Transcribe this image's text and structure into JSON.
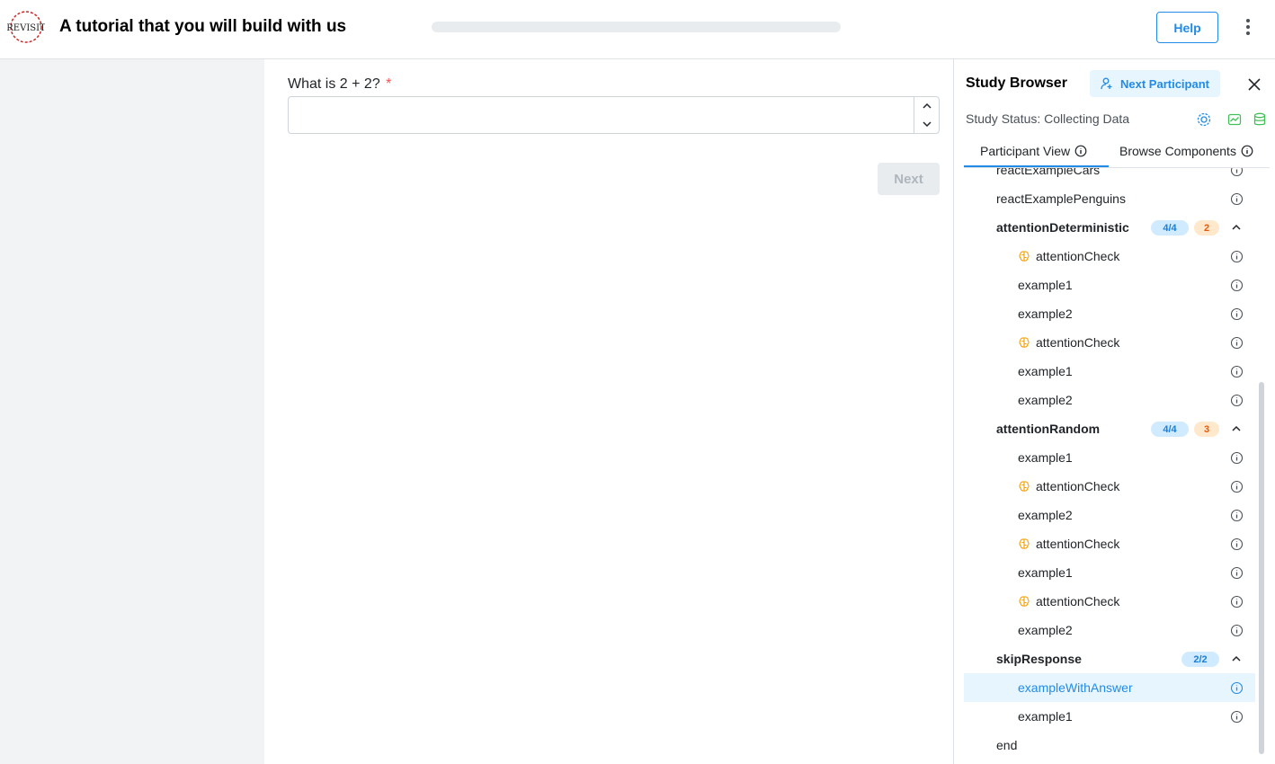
{
  "header": {
    "title": "A tutorial that you will build with us",
    "logo_text": "REVISIT",
    "help_label": "Help"
  },
  "question": {
    "label": "What is 2 + 2?",
    "required_mark": "*",
    "value": "",
    "next_label": "Next"
  },
  "study_browser": {
    "title": "Study Browser",
    "next_participant_label": "Next Participant",
    "status": "Study Status: Collecting Data",
    "tabs": [
      {
        "label": "Participant View",
        "active": true
      },
      {
        "label": "Browse Components",
        "active": false
      }
    ],
    "colors": {
      "accent": "#228be6",
      "brain": "#f59f00",
      "green": "#40c057"
    },
    "items": [
      {
        "label": "reactExampleCars",
        "type": "item",
        "indent": 0,
        "partial": true
      },
      {
        "label": "reactExamplePenguins",
        "type": "item",
        "indent": 0
      },
      {
        "label": "attentionDeterministic",
        "type": "block",
        "indent": 0,
        "count": "4/4",
        "attention": "2"
      },
      {
        "label": "attentionCheck",
        "type": "item",
        "indent": 1,
        "icon": "brain-icon"
      },
      {
        "label": "example1",
        "type": "item",
        "indent": 1
      },
      {
        "label": "example2",
        "type": "item",
        "indent": 1
      },
      {
        "label": "attentionCheck",
        "type": "item",
        "indent": 1,
        "icon": "brain-icon"
      },
      {
        "label": "example1",
        "type": "item",
        "indent": 1
      },
      {
        "label": "example2",
        "type": "item",
        "indent": 1
      },
      {
        "label": "attentionRandom",
        "type": "block",
        "indent": 0,
        "count": "4/4",
        "attention": "3"
      },
      {
        "label": "example1",
        "type": "item",
        "indent": 1
      },
      {
        "label": "attentionCheck",
        "type": "item",
        "indent": 1,
        "icon": "brain-icon"
      },
      {
        "label": "example2",
        "type": "item",
        "indent": 1
      },
      {
        "label": "attentionCheck",
        "type": "item",
        "indent": 1,
        "icon": "brain-icon"
      },
      {
        "label": "example1",
        "type": "item",
        "indent": 1
      },
      {
        "label": "attentionCheck",
        "type": "item",
        "indent": 1,
        "icon": "brain-icon"
      },
      {
        "label": "example2",
        "type": "item",
        "indent": 1
      },
      {
        "label": "skipResponse",
        "type": "block",
        "indent": 0,
        "count": "2/2"
      },
      {
        "label": "exampleWithAnswer",
        "type": "item",
        "indent": 1,
        "selected": true
      },
      {
        "label": "example1",
        "type": "item",
        "indent": 1
      },
      {
        "label": "end",
        "type": "item",
        "indent": 0,
        "no_info": true
      }
    ]
  }
}
